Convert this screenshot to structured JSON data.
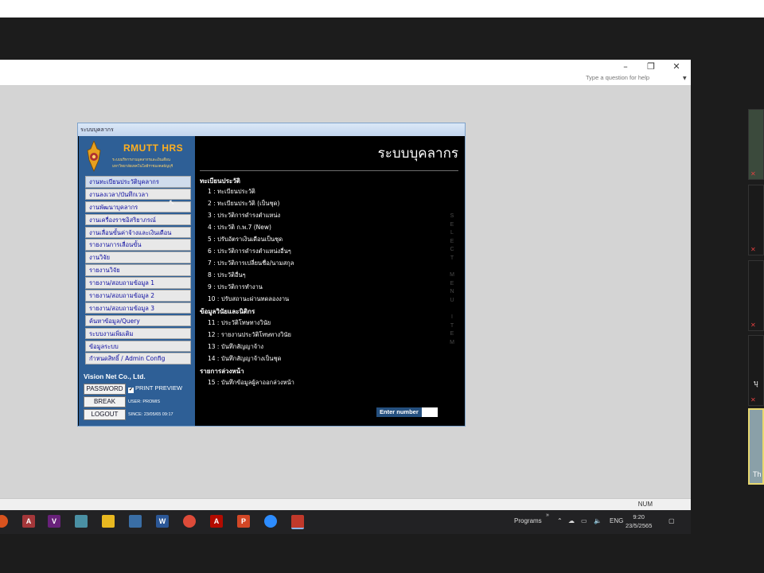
{
  "titlebar": {
    "minimize": "–",
    "restore": "❐",
    "close": "✕",
    "help_placeholder": "Type a question for help"
  },
  "statusbar": {
    "num": "NUM"
  },
  "form": {
    "window_title": "ระบบบุคลากร",
    "logo_title": "RMUTT HRS",
    "logo_sub1": "ระบบบริหารงานบุคลากรและเงินเดือน",
    "logo_sub2": "มหาวิทยาลัยเทคโนโลยีราชมงคลธัญบุรี",
    "menu_items": [
      "งานทะเบียนประวัติบุคลากร",
      "งานลงเวลา/บันทึกเวลา",
      "งานพัฒนาบุคลากร",
      "งานเครื่องราชอิสริยาภรณ์",
      "งานเลื่อนขั้นค่าจ้างและเงินเดือน",
      "รายงานการเลื่อนขั้น",
      "งานวิจัย",
      "รายงานวิจัย",
      "รายงาน/สอบถามข้อมูล 1",
      "รายงาน/สอบถามข้อมูล 2",
      "รายงาน/สอบถามข้อมูล 3",
      "ค้นหาข้อมูล/Query",
      "ระบบงานเพิ่มเติม",
      "ข้อมูลระบบ",
      "กำหนดสิทธิ์ / Admin Config"
    ],
    "company": "Vision Net Co., Ltd.",
    "password_btn": "PASSWORD",
    "print_preview": "PRINT PREVIEW",
    "break_btn": "BREAK",
    "logout_btn": "LOGOUT",
    "user": "USER: PROMIS",
    "since": "SINCE: 23/05/65 09:17",
    "big_title": "ระบบบุคลากร",
    "sections": [
      {
        "title": "ทะเบียนประวัติ",
        "options": [
          "1 : ทะเบียนประวัติ",
          "2 : ทะเบียนประวัติ (เป็นชุด)",
          "3 : ประวัติการดำรงตำแหน่ง",
          "4 : ประวัติ ก.พ.7 (New)",
          "5 : ปรับอัตราเงินเดือนเป็นชุด",
          "6 : ประวัติการดำรงตำแหน่งอื่นๆ",
          "7 : ประวัติการเปลี่ยนชื่อ/นามสกุล",
          "8 : ประวัติอื่นๆ",
          "9 : ประวัติการทำงาน",
          "10 : ปรับสถานะผ่านทดลองงาน"
        ]
      },
      {
        "title": "ข้อมูลวินัยและนิติกร",
        "options": [
          "11 : ประวัติโทษทางวินัย",
          "12 : รายงานประวัติโทษทางวินัย",
          "13 : บันทึกสัญญาจ้าง",
          "14 : บันทึกสัญญาจ้างเป็นชุด"
        ]
      },
      {
        "title": "รายการล่วงหน้า",
        "options": [
          "15 : บันทึกข้อมูลผู้ลาออกล่วงหน้า"
        ]
      }
    ],
    "vertical_text": "SELECT MENU ITEM",
    "enter_label": "Enter number",
    "enter_value": ""
  },
  "taskbar": {
    "icons": [
      "chrome-like",
      "access",
      "visual-studio",
      "notes",
      "file-explorer",
      "remote",
      "word",
      "chrome",
      "acrobat",
      "powerpoint",
      "zoom",
      "app-active"
    ],
    "programs": "Programs",
    "lang": "ENG",
    "time": "9:20",
    "date": "23/5/2565"
  },
  "side": {
    "partial_name": "บุ",
    "partial_label": "Th"
  }
}
